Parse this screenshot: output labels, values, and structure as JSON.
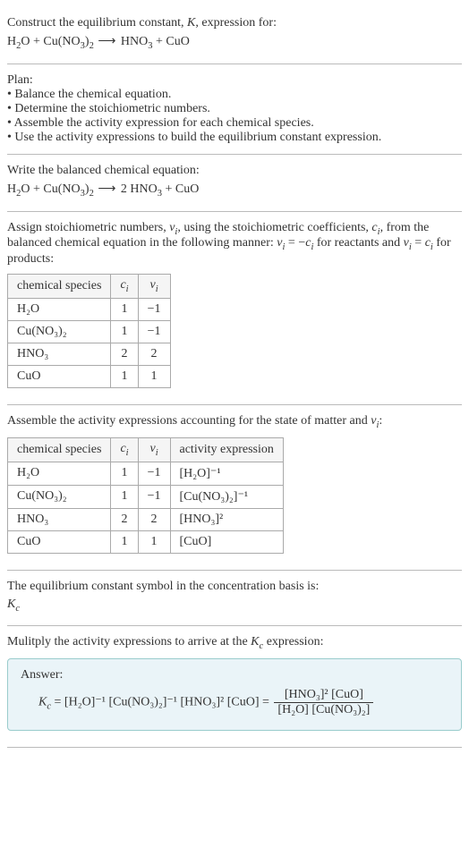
{
  "header": {
    "title_prefix": "Construct the equilibrium constant, ",
    "title_k": "K",
    "title_suffix": ", expression for:"
  },
  "unbalanced_eq": {
    "H2O": "H",
    "sub2": "2",
    "O": "O",
    "plus1": " + ",
    "Cu": "Cu(NO",
    "sub3a": "3",
    "paren": ")",
    "sub2b": "2",
    "arrow": " ⟶ ",
    "HNO": "HNO",
    "sub3b": "3",
    "plus2": " + ",
    "CuO": "CuO"
  },
  "plan": {
    "title": "Plan:",
    "b1": "• Balance the chemical equation.",
    "b2": "• Determine the stoichiometric numbers.",
    "b3": "• Assemble the activity expression for each chemical species.",
    "b4": "• Use the activity expressions to build the equilibrium constant expression."
  },
  "balanced": {
    "title": "Write the balanced chemical equation:",
    "H2O": "H",
    "sub2": "2",
    "O": "O",
    "plus1": " + ",
    "Cu": "Cu(NO",
    "sub3a": "3",
    "paren": ")",
    "sub2b": "2",
    "arrow": " ⟶ ",
    "coef2": "2 ",
    "HNO": "HNO",
    "sub3b": "3",
    "plus2": " + ",
    "CuO": "CuO"
  },
  "stoich": {
    "intro1": "Assign stoichiometric numbers, ",
    "nu": "ν",
    "i": "i",
    "intro2": ", using the stoichiometric coefficients, ",
    "c": "c",
    "intro3": ", from the balanced chemical equation in the following manner: ",
    "eq1": " = −",
    "intro4": " for reactants and ",
    "eq2": " = ",
    "intro5": " for products:",
    "h_species": "chemical species",
    "h_ci": "c",
    "h_nui": "ν",
    "r1s": "H₂O",
    "r1c": "1",
    "r1n": "−1",
    "r2s": "Cu(NO₃)₂",
    "r2c": "1",
    "r2n": "−1",
    "r3s": "HNO₃",
    "r3c": "2",
    "r3n": "2",
    "r4s": "CuO",
    "r4c": "1",
    "r4n": "1"
  },
  "activity": {
    "intro1": "Assemble the activity expressions accounting for the state of matter and ",
    "nu": "ν",
    "i": "i",
    "colon": ":",
    "h_species": "chemical species",
    "h_ci": "c",
    "h_nui": "ν",
    "h_act": "activity expression",
    "r1s": "H₂O",
    "r1c": "1",
    "r1n": "−1",
    "r1a": "[H₂O]⁻¹",
    "r2s": "Cu(NO₃)₂",
    "r2c": "1",
    "r2n": "−1",
    "r2a": "[Cu(NO₃)₂]⁻¹",
    "r3s": "HNO₃",
    "r3c": "2",
    "r3n": "2",
    "r3a": "[HNO₃]²",
    "r4s": "CuO",
    "r4c": "1",
    "r4n": "1",
    "r4a": "[CuO]"
  },
  "kc_symbol": {
    "line1": "The equilibrium constant symbol in the concentration basis is:",
    "K": "K",
    "c": "c"
  },
  "multiply": {
    "line_prefix": "Mulitply the activity expressions to arrive at the ",
    "K": "K",
    "c": "c",
    "line_suffix": " expression:"
  },
  "answer": {
    "label": "Answer:",
    "Kc_K": "K",
    "Kc_c": "c",
    "eq": " = ",
    "t1": "[H₂O]⁻¹",
    "t2": "[Cu(NO₃)₂]⁻¹",
    "t3": "[HNO₃]²",
    "t4": "[CuO]",
    "eq2": " = ",
    "num1": "[HNO₃]²",
    "num2": "[CuO]",
    "den1": "[H₂O]",
    "den2": "[Cu(NO₃)₂]"
  }
}
